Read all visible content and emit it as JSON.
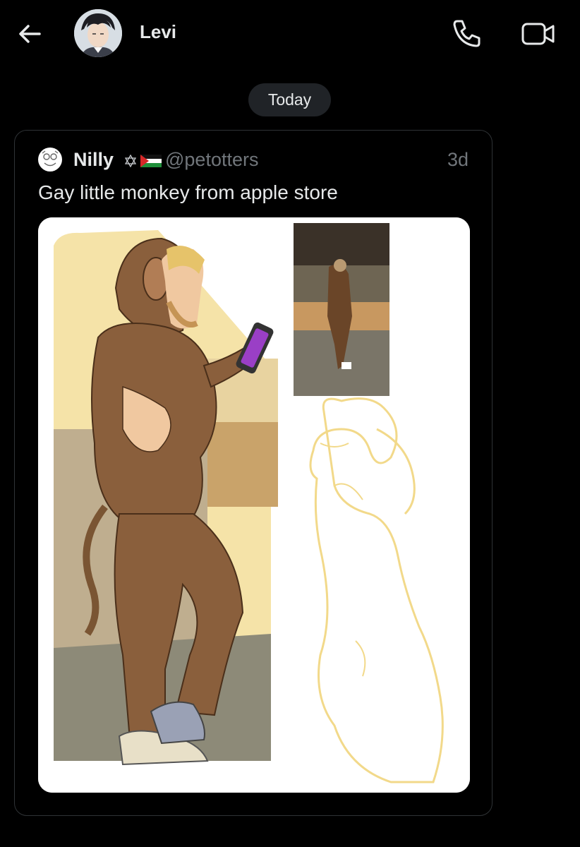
{
  "header": {
    "contact_name": "Levi",
    "back_icon": "arrow-left-icon",
    "call_icon": "phone-icon",
    "video_icon": "video-camera-icon"
  },
  "conversation": {
    "date_separator": "Today"
  },
  "shared_post": {
    "author_name": "Nilly",
    "author_emoji": "✡🇵🇸",
    "author_handle": "@petotters",
    "timestamp": "3d",
    "text": "Gay little monkey from apple store",
    "media_description": "Illustration of man in brown monkey costume holding a phone in an Apple store, with a small reference photo and a yellow sketch"
  },
  "colors": {
    "background": "#000000",
    "text_primary": "#e7e9ea",
    "text_secondary": "#71767b",
    "pill_bg": "#202327",
    "card_border": "#2f3336"
  }
}
